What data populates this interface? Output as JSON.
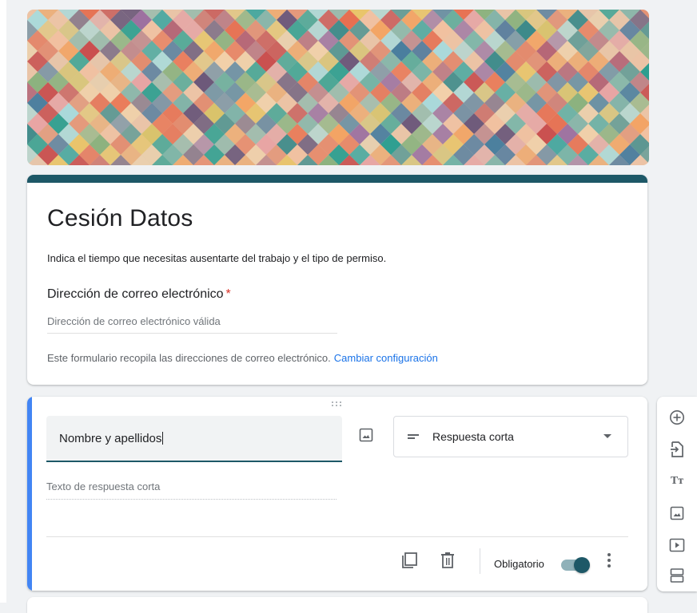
{
  "form": {
    "title": "Cesión Datos",
    "description": "Indica el tiempo que necesitas ausentarte del trabajo y el tipo de permiso.",
    "accent_color": "#1d5867"
  },
  "email_section": {
    "label": "Dirección de correo electrónico",
    "required_mark": "*",
    "placeholder": "Dirección de correo electrónico válida",
    "note": "Este formulario recopila las direcciones de correo electrónico.",
    "change_link": "Cambiar configuración"
  },
  "question": {
    "title_value": "Nombre y apellidos",
    "type_label": "Respuesta corta",
    "answer_placeholder": "Texto de respuesta corta",
    "required_label": "Obligatorio",
    "required_on": true,
    "drag_handle": "⠿"
  },
  "toolbar": {
    "items": [
      "add-question-icon",
      "import-questions-icon",
      "add-title-icon",
      "add-image-icon",
      "add-video-icon",
      "add-section-icon"
    ],
    "title_glyph": "Tт"
  },
  "colors": {
    "active_border": "#4285f4",
    "link": "#1a73e8",
    "required": "#d93025"
  }
}
